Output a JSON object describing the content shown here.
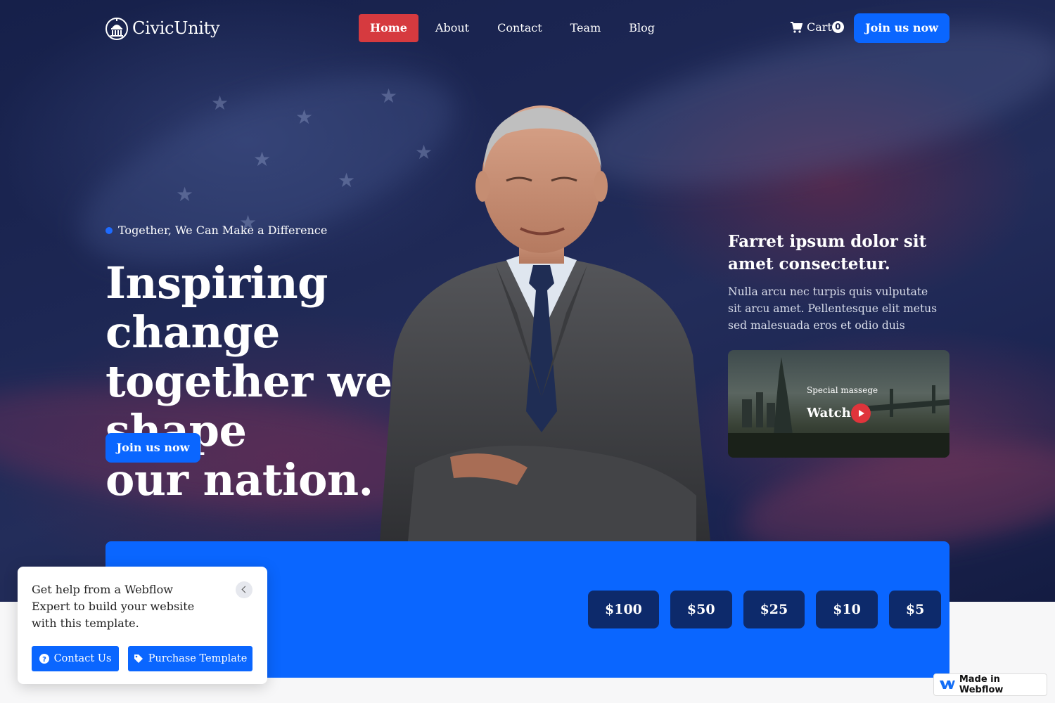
{
  "brand": {
    "name": "CivicUnity"
  },
  "nav": {
    "items": [
      {
        "label": "Home",
        "active": true
      },
      {
        "label": "About"
      },
      {
        "label": "Contact"
      },
      {
        "label": "Team"
      },
      {
        "label": "Blog"
      }
    ],
    "cart_label": "Cart",
    "cart_count": "0",
    "join_label": "Join us now"
  },
  "hero": {
    "eyebrow": "Together, We Can Make a Difference",
    "headline_lines": [
      "Inspiring change",
      "together we shape",
      "our nation."
    ],
    "cta": "Join us now",
    "side_title": "Farret ipsum dolor sit amet consectetur.",
    "side_text": "Nulla arcu nec turpis quis vulputate sit arcu amet. Pellentesque elit metus sed malesuada eros et odio duis",
    "video": {
      "subtitle": "Special massege",
      "watch": "Watch"
    }
  },
  "donate": {
    "amounts": [
      "$100",
      "$50",
      "$25",
      "$10",
      "$5"
    ]
  },
  "popup": {
    "text": "Get help from a Webflow Expert to build your website with this template.",
    "contact_label": "Contact Us",
    "purchase_label": "Purchase Template"
  },
  "badge": {
    "label": "Made in Webflow"
  },
  "colors": {
    "accent_blue": "#0a66ff",
    "active_red": "#d63a3f",
    "navy": "#0d2a6b"
  },
  "icons": [
    "capitol-icon",
    "cart-icon",
    "play-icon",
    "question-icon",
    "tag-icon",
    "webflow-icon",
    "chevron-left-icon"
  ]
}
